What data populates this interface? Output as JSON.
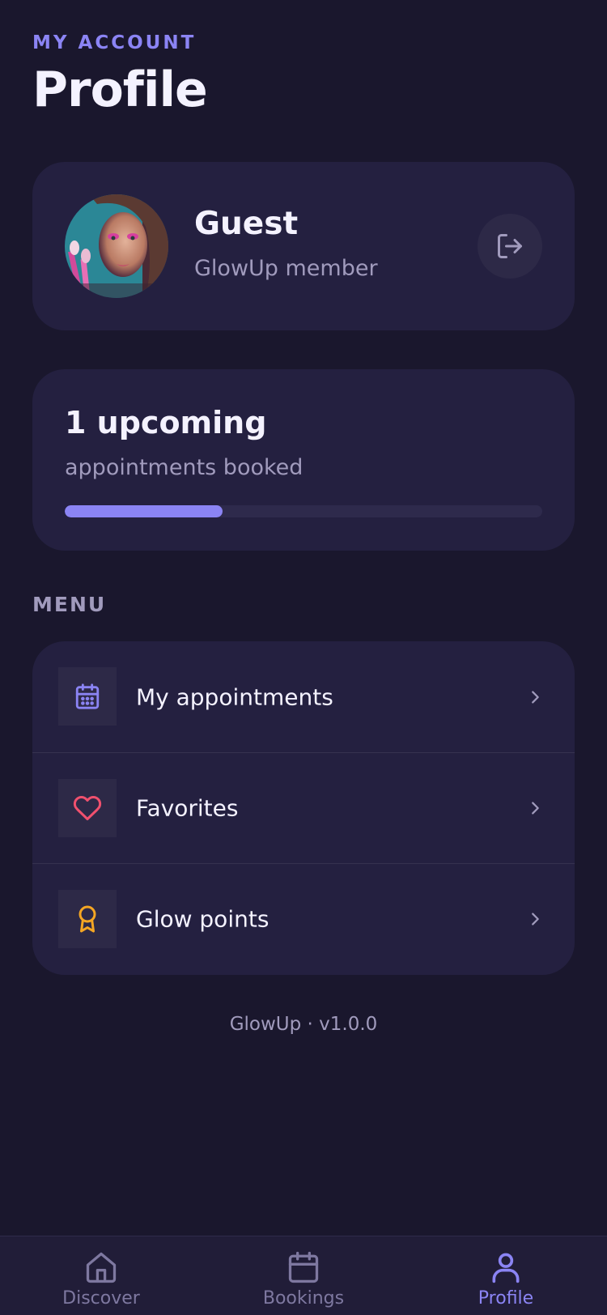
{
  "header": {
    "eyebrow": "MY ACCOUNT",
    "title": "Profile"
  },
  "profile": {
    "name": "Guest",
    "subtitle": "GlowUp member",
    "avatar_icon": "user-photo",
    "logout_icon": "logout-icon"
  },
  "stats": {
    "title": "1 upcoming",
    "subtitle": "appointments booked",
    "progress": 0.33
  },
  "menu": {
    "section_label": "MENU",
    "items": [
      {
        "label": "My appointments",
        "icon": "calendar-icon",
        "icon_color": "#8b84f4"
      },
      {
        "label": "Favorites",
        "icon": "heart-icon",
        "icon_color": "#f0506e"
      },
      {
        "label": "Glow points",
        "icon": "award-icon",
        "icon_color": "#f5a623"
      }
    ]
  },
  "footer": {
    "version": "GlowUp · v1.0.0"
  },
  "tabbar": {
    "tabs": [
      {
        "label": "Discover",
        "icon": "home-icon",
        "active": false
      },
      {
        "label": "Bookings",
        "icon": "calendar-icon",
        "active": false
      },
      {
        "label": "Profile",
        "icon": "user-icon",
        "active": true
      }
    ]
  },
  "colors": {
    "background": "#1a172d",
    "card": "#242040",
    "accent": "#8b84f4",
    "muted_text": "#a19bbd"
  }
}
